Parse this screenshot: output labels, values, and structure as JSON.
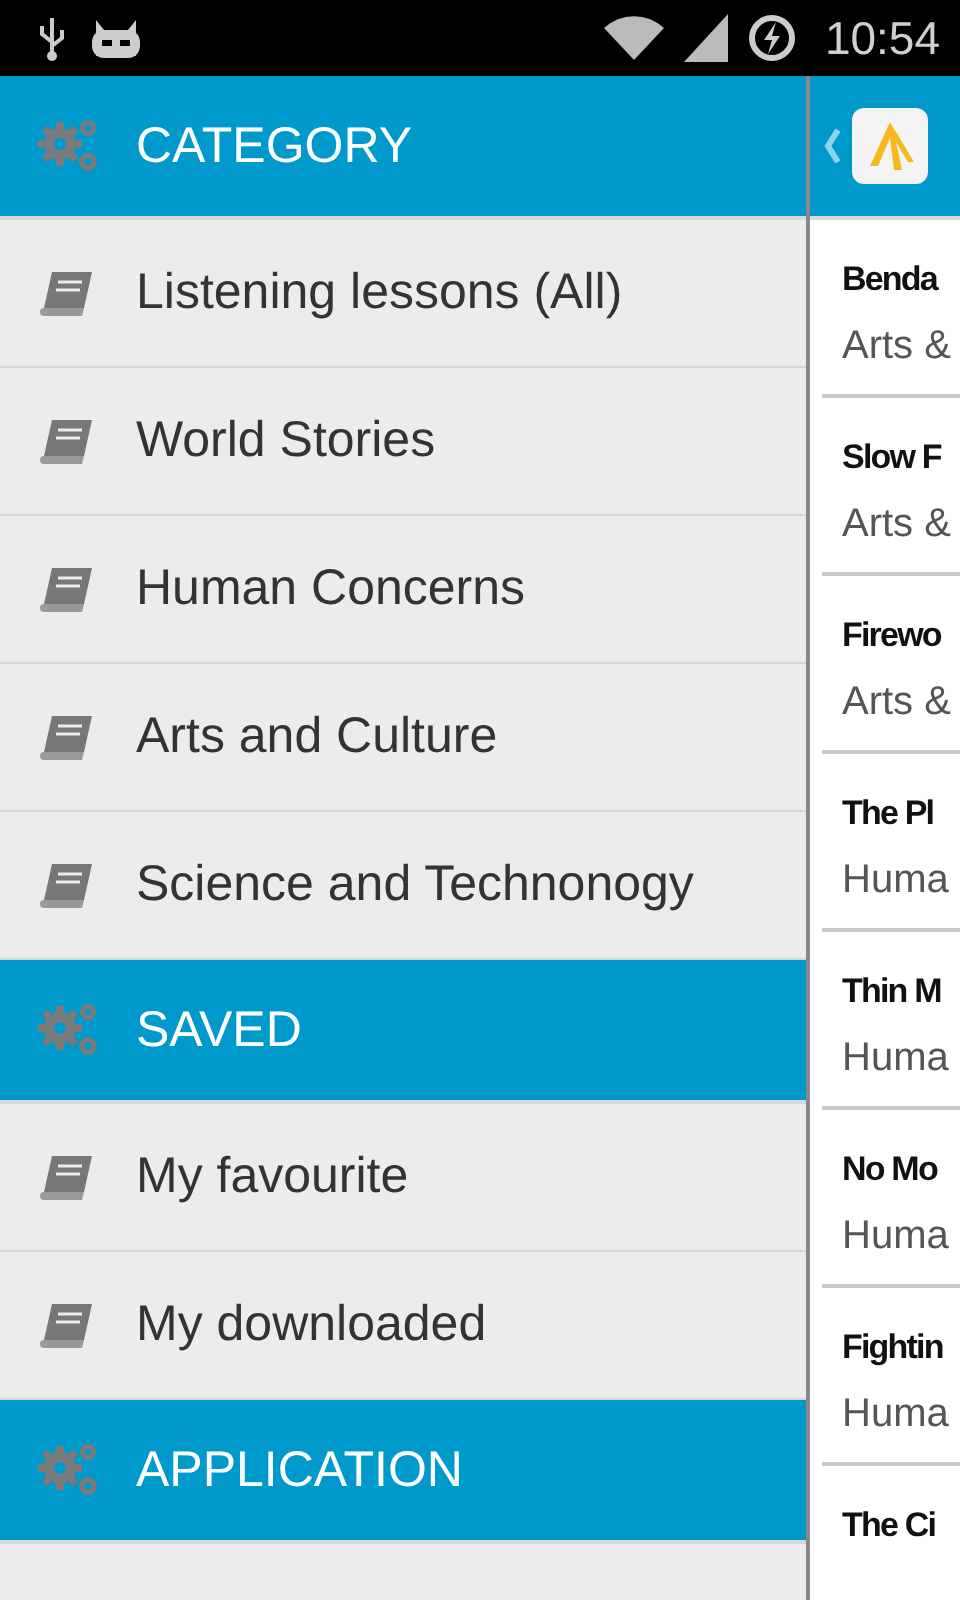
{
  "status_bar": {
    "time": "10:54"
  },
  "drawer": {
    "sections": [
      {
        "title": "CATEGORY",
        "items": [
          {
            "label": "Listening lessons (All)"
          },
          {
            "label": "World Stories"
          },
          {
            "label": "Human Concerns"
          },
          {
            "label": "Arts and Culture"
          },
          {
            "label": "Science and Technonogy"
          }
        ]
      },
      {
        "title": "SAVED",
        "items": [
          {
            "label": "My favourite"
          },
          {
            "label": "My downloaded"
          }
        ]
      },
      {
        "title": "APPLICATION"
      }
    ]
  },
  "lessons": [
    {
      "title": "Benda",
      "category": "Arts &"
    },
    {
      "title": "Slow F",
      "category": "Arts &"
    },
    {
      "title": "Firewo",
      "category": "Arts &"
    },
    {
      "title": "The Pl",
      "category": "Huma"
    },
    {
      "title": "Thin M",
      "category": "Huma"
    },
    {
      "title": "No Mo",
      "category": "Huma"
    },
    {
      "title": "Fightin",
      "category": "Huma"
    },
    {
      "title": "The Ci"
    }
  ]
}
